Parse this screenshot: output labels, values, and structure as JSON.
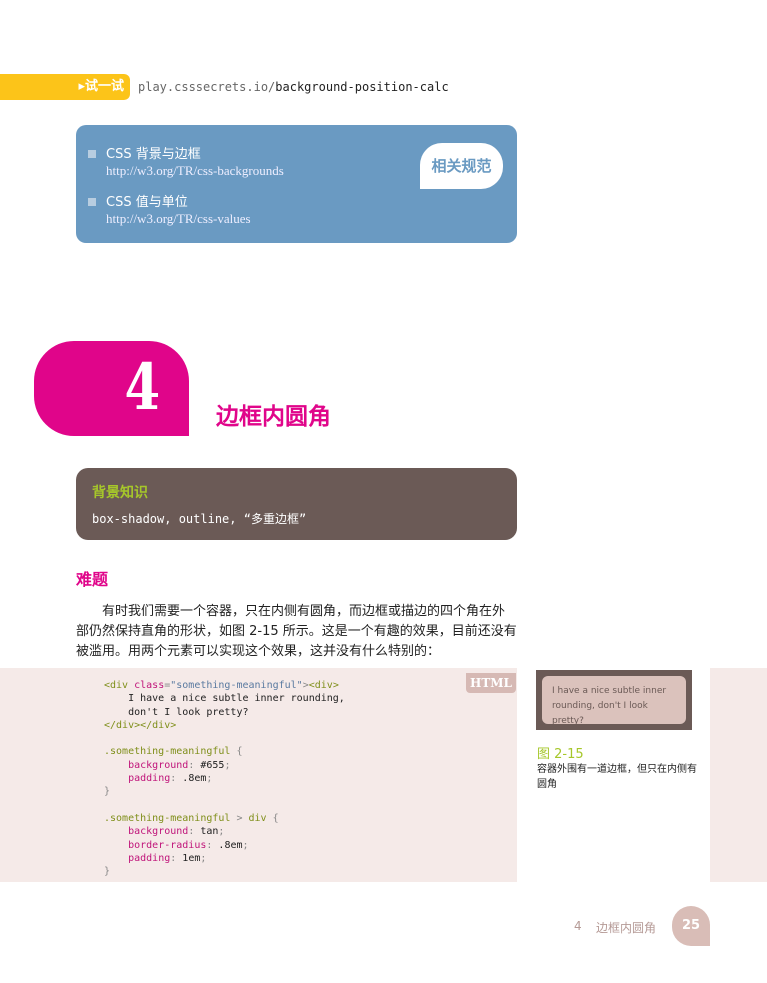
{
  "try_it": {
    "label": "▸试一试",
    "url_prefix": "play.csssecrets.io/",
    "url_path": "background-position-calc"
  },
  "specs": {
    "tag": "相关规范",
    "items": [
      {
        "title": "CSS 背景与边框",
        "url": "http://w3.org/TR/css-backgrounds"
      },
      {
        "title": "CSS 值与单位",
        "url": "http://w3.org/TR/css-values"
      }
    ]
  },
  "chapter": {
    "number": "4",
    "title": "边框内圆角"
  },
  "background": {
    "title": "背景知识",
    "text": "box-shadow, outline, “多重边框”"
  },
  "problem": {
    "heading": "难题",
    "paragraph": "有时我们需要一个容器，只在内侧有圆角，而边框或描边的四个角在外部仍然保持直角的形状，如图 2-15 所示。这是一个有趣的效果，目前还没有被滥用。用两个元素可以实现这个效果，这并没有什么特别的："
  },
  "code": {
    "lang": "HTML",
    "lines": [
      [
        [
          "<div ",
          "tag"
        ],
        [
          "class",
          "attr"
        ],
        [
          "=",
          "pun"
        ],
        [
          "\"something-meaningful\"",
          "str"
        ],
        [
          ">",
          "pun"
        ],
        [
          "<div>",
          "tag"
        ]
      ],
      [
        [
          "    I have a nice subtle inner rounding,",
          ""
        ]
      ],
      [
        [
          "    don't I look pretty?",
          ""
        ]
      ],
      [
        [
          "</div></div>",
          "tag"
        ]
      ],
      [
        [
          "",
          ""
        ]
      ],
      [
        [
          ".something-meaningful ",
          "sel"
        ],
        [
          "{",
          "pun"
        ]
      ],
      [
        [
          "    ",
          ""
        ],
        [
          "background",
          "prop"
        ],
        [
          ": ",
          "pun"
        ],
        [
          "#655",
          ""
        ],
        [
          ";",
          "pun"
        ]
      ],
      [
        [
          "    ",
          ""
        ],
        [
          "padding",
          "prop"
        ],
        [
          ": ",
          "pun"
        ],
        [
          ".8em",
          ""
        ],
        [
          ";",
          "pun"
        ]
      ],
      [
        [
          "}",
          "pun"
        ]
      ],
      [
        [
          "",
          ""
        ]
      ],
      [
        [
          ".something-meaningful ",
          "sel"
        ],
        [
          "> ",
          "pun"
        ],
        [
          "div ",
          "sel"
        ],
        [
          "{",
          "pun"
        ]
      ],
      [
        [
          "    ",
          ""
        ],
        [
          "background",
          "prop"
        ],
        [
          ": ",
          "pun"
        ],
        [
          "tan",
          ""
        ],
        [
          ";",
          "pun"
        ]
      ],
      [
        [
          "    ",
          ""
        ],
        [
          "border-radius",
          "prop"
        ],
        [
          ": ",
          "pun"
        ],
        [
          ".8em",
          ""
        ],
        [
          ";",
          "pun"
        ]
      ],
      [
        [
          "    ",
          ""
        ],
        [
          "padding",
          "prop"
        ],
        [
          ": ",
          "pun"
        ],
        [
          "1em",
          ""
        ],
        [
          ";",
          "pun"
        ]
      ],
      [
        [
          "}",
          "pun"
        ]
      ]
    ]
  },
  "figure": {
    "demo_text": "I have a nice subtle inner rounding, don't I look pretty?",
    "number": "图 2-15",
    "caption": "容器外围有一道边框，但只在内侧有圆角"
  },
  "footer": {
    "chapter": "4",
    "title": "边框内圆角",
    "page": "25"
  },
  "colors": {
    "accent": "#e0058a",
    "try": "#fcc419",
    "spec": "#6a9ac2",
    "box": "#6b5a56",
    "green": "#a6c72a"
  }
}
